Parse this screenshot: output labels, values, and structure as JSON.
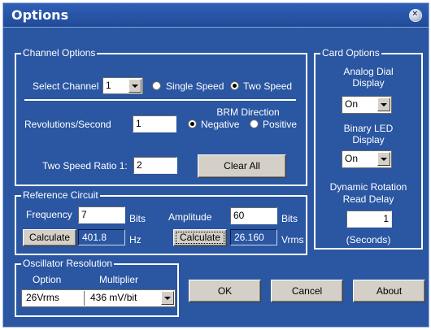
{
  "window": {
    "title": "Options",
    "close_glyph": "×"
  },
  "channel_options": {
    "label": "Channel Options",
    "select_channel_label": "Select Channel",
    "select_channel_value": "1",
    "single_speed_label": "Single Speed",
    "two_speed_label": "Two Speed",
    "speed_selected": "Two Speed",
    "revolutions_label": "Revolutions/Second",
    "revolutions_value": "1",
    "brm_direction_label": "BRM Direction",
    "negative_label": "Negative",
    "positive_label": "Positive",
    "direction_selected": "Negative",
    "two_speed_ratio_label": "Two Speed Ratio 1:",
    "two_speed_ratio_value": "2",
    "clear_all_label": "Clear All"
  },
  "reference_circuit": {
    "label": "Reference Circuit",
    "frequency_label": "Frequency",
    "frequency_value": "7",
    "frequency_unit": "Bits",
    "amplitude_label": "Amplitude",
    "amplitude_value": "60",
    "amplitude_unit": "Bits",
    "calc1_label": "Calculate",
    "frequency_result": "401.8",
    "frequency_result_unit": "Hz",
    "calc2_label": "Calculate",
    "amplitude_result": "26.160",
    "amplitude_result_unit": "Vrms"
  },
  "oscillator_resolution": {
    "label": "Oscillator Resolution",
    "option_header": "Option",
    "multiplier_header": "Multiplier",
    "option_value": "26Vrms",
    "multiplier_value": "436 mV/bit"
  },
  "card_options": {
    "label": "Card Options",
    "analog_dial_label_1": "Analog Dial",
    "analog_dial_label_2": "Display",
    "analog_dial_value": "On",
    "binary_led_label_1": "Binary LED",
    "binary_led_label_2": "Display",
    "binary_led_value": "On",
    "dynamic_rotation_label_1": "Dynamic Rotation",
    "dynamic_rotation_label_2": "Read Delay",
    "dynamic_rotation_value": "1",
    "seconds_label": "(Seconds)"
  },
  "buttons": {
    "ok": "OK",
    "cancel": "Cancel",
    "about": "About"
  },
  "colors": {
    "background": "#2a56a2",
    "titlebar": "#214b97",
    "text": "#ffffff",
    "button_face": "#d4d0c8"
  },
  "icons": {
    "close": "close-icon",
    "dropdown": "chevron-down-icon"
  }
}
